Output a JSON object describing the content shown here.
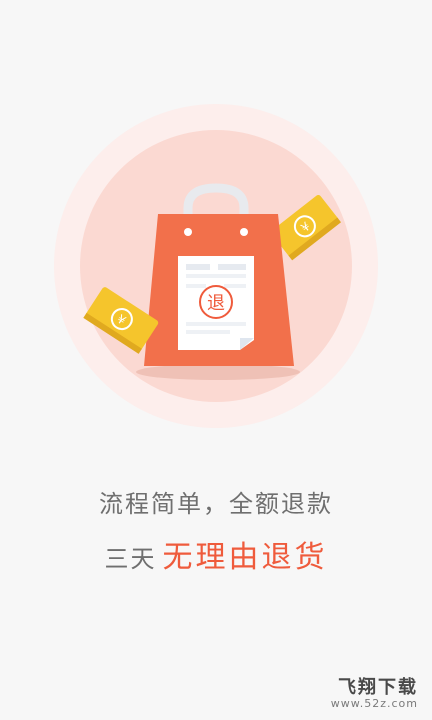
{
  "illustration": {
    "bag_stamp_text": "退"
  },
  "content": {
    "tagline": "流程简单，全额退款",
    "headline_prefix": "三天",
    "headline_emphasis": "无理由退货"
  },
  "watermark": {
    "title": "飞翔下载",
    "url": "www.52z.com"
  },
  "colors": {
    "background": "#f7f7f7",
    "accent": "#ef5b3c",
    "bag": "#f2704b",
    "coin_yellow": "#f5c52c",
    "text_gray": "#6f6f6f"
  }
}
